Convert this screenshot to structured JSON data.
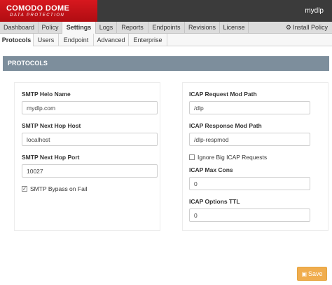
{
  "brand": {
    "name": "COMODO DOME",
    "tagline": "DATA PROTECTION"
  },
  "user": "mydlp",
  "main_nav": {
    "tabs": [
      "Dashboard",
      "Policy",
      "Settings",
      "Logs",
      "Reports",
      "Endpoints",
      "Revisions",
      "License"
    ],
    "active": "Settings",
    "install_policy": "Install Policy"
  },
  "sub_nav": {
    "tabs": [
      "Protocols",
      "Users",
      "Endpoint",
      "Advanced",
      "Enterprise"
    ],
    "active": "Protocols"
  },
  "panel_title": "PROTOCOLS",
  "smtp": {
    "helo_name": {
      "label": "SMTP Helo Name",
      "value": "mydlp.com"
    },
    "next_hop_host": {
      "label": "SMTP Next Hop Host",
      "value": "localhost"
    },
    "next_hop_port": {
      "label": "SMTP Next Hop Port",
      "value": "10027"
    },
    "bypass_on_fail": {
      "label": "SMTP Bypass on Fail",
      "checked": true,
      "mark": "✓"
    }
  },
  "icap": {
    "request_mod_path": {
      "label": "ICAP Request Mod Path",
      "value": "/dlp"
    },
    "response_mod_path": {
      "label": "ICAP Response Mod Path",
      "value": "/dlp-respmod"
    },
    "ignore_big_requests": {
      "label": "Ignore Big ICAP Requests",
      "checked": false
    },
    "max_cons": {
      "label": "ICAP Max Cons",
      "value": "0"
    },
    "options_ttl": {
      "label": "ICAP Options TTL",
      "value": "0"
    }
  },
  "save_label": "Save",
  "icons": {
    "install": "gear-icon",
    "save": "floppy-disk-icon"
  },
  "colors": {
    "brand_red": "#c8141b",
    "topbar": "#3b3b3b",
    "panel_header": "#7d8e9c",
    "save": "#f0ad4e"
  }
}
